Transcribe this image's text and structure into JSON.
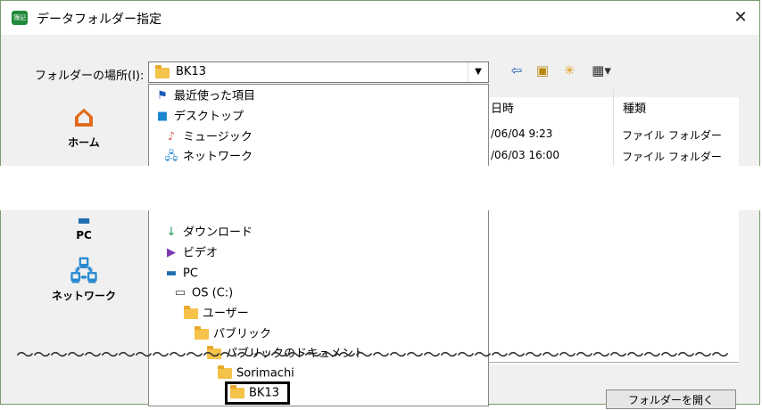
{
  "window": {
    "title": "データフォルダー指定",
    "app_icon_text": "簿記"
  },
  "location": {
    "label": "フォルダーの場所(I):",
    "value": "BK13"
  },
  "sidebar": {
    "home": "ホーム",
    "pc": "PC",
    "network": "ネットワーク"
  },
  "columns": {
    "date": "日時",
    "type": "種類"
  },
  "rows": [
    {
      "date": "/06/04 9:23",
      "type": "ファイル フォルダー"
    },
    {
      "date": "/06/03 16:00",
      "type": "ファイル フォルダー"
    }
  ],
  "dropdown": {
    "recent": "最近使った項目",
    "desktop": "デスクトップ",
    "music": "ミュージック",
    "network": "ネットワーク",
    "downloads": "ダウンロード",
    "videos": "ビデオ",
    "pc": "PC",
    "os": "OS (C:)",
    "users": "ユーザー",
    "public": "パブリック",
    "public_docs": "パブリックのドキュメント",
    "sorimachi": "Sorimachi",
    "bk13": "BK13"
  },
  "buttons": {
    "open_folder": "フォルダーを開く"
  },
  "break_mark": "〜〜〜〜〜〜〜〜〜〜〜〜〜〜〜〜〜〜〜〜〜〜〜〜〜〜〜〜〜〜〜〜〜〜〜〜〜〜〜〜〜〜"
}
